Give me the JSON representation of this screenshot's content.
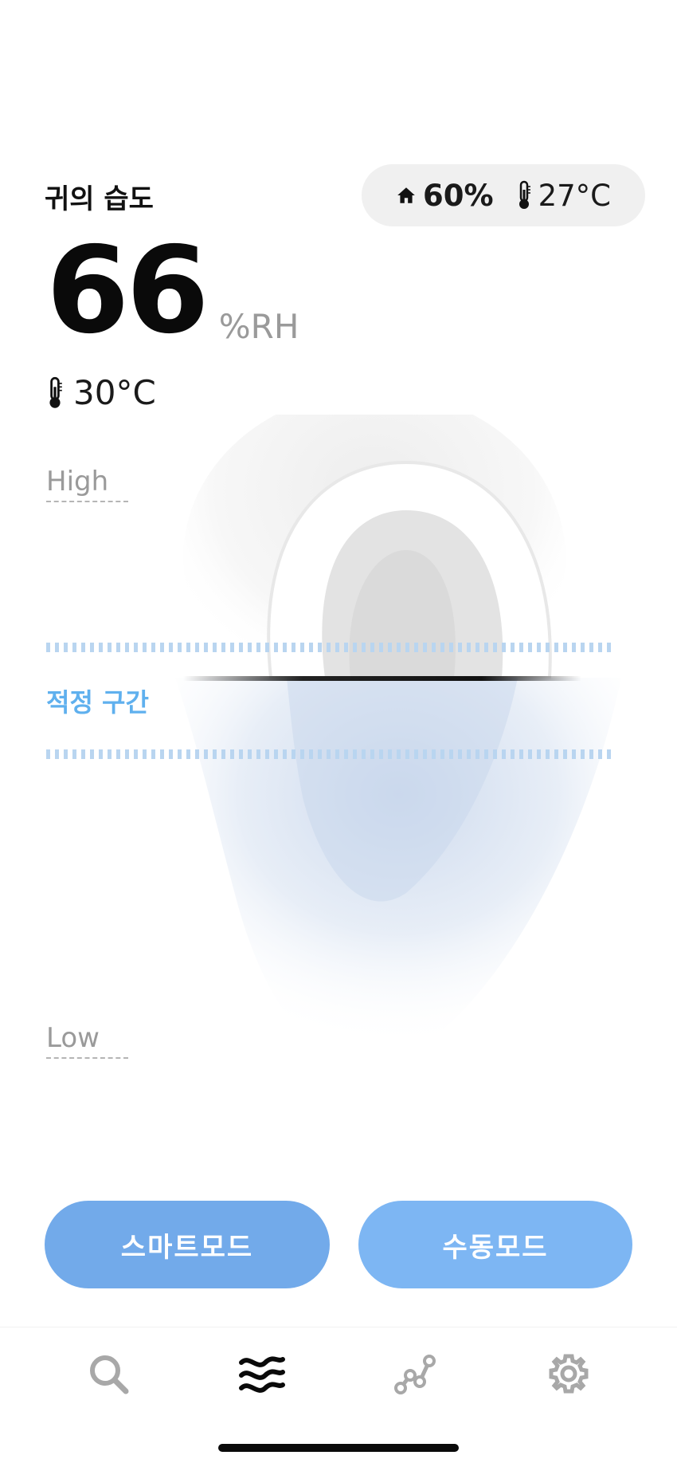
{
  "header": {
    "title": "귀의 습도"
  },
  "environment": {
    "home_icon": "home-icon",
    "room_humidity": "60%",
    "thermo_icon": "thermometer-icon",
    "room_temperature": "27°C"
  },
  "reading": {
    "humidity_value": "66",
    "humidity_unit": "%RH",
    "ear_temperature": "30°C"
  },
  "gauge": {
    "high_label": "High",
    "optimal_label": "적정 구간",
    "low_label": "Low"
  },
  "modes": {
    "smart_label": "스마트모드",
    "manual_label": "수동모드"
  },
  "tabbar": {
    "items": [
      {
        "icon": "search-icon",
        "active": false
      },
      {
        "icon": "waves-icon",
        "active": true
      },
      {
        "icon": "graph-icon",
        "active": false
      },
      {
        "icon": "gear-icon",
        "active": false
      }
    ]
  },
  "colors": {
    "accent": "#5fb0ee",
    "button": "#72aaea",
    "button_alt": "#7db6f3",
    "muted": "#9a9a9a"
  }
}
